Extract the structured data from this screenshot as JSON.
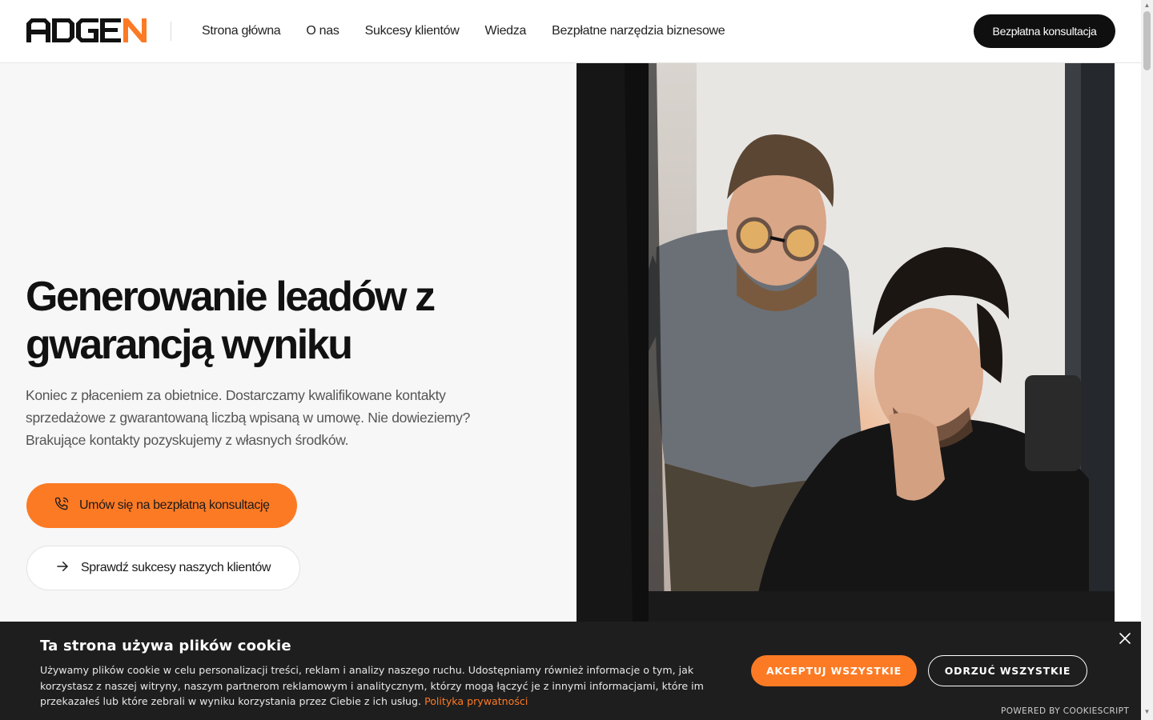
{
  "header": {
    "logo_text": "ADGEN",
    "nav": [
      {
        "label": "Strona główna"
      },
      {
        "label": "O nas"
      },
      {
        "label": "Sukcesy klientów"
      },
      {
        "label": "Wiedza"
      },
      {
        "label": "Bezpłatne narzędzia biznesowe"
      }
    ],
    "cta_label": "Bezpłatna konsultacja"
  },
  "hero": {
    "title_line1": "Generowanie leadów z",
    "title_line2": "gwarancją wyniku",
    "subtitle": "Koniec z płaceniem za obietnice. Dostarczamy kwalifikowane kontakty sprzedażowe z gwarantowaną liczbą wpisaną w umowę. Nie dowieziemy? Brakujące kontakty pozyskujemy z własnych środków.",
    "primary_button": "Umów się na bezpłatną konsultację",
    "primary_icon": "phone-icon",
    "secondary_button": "Sprawdź sukcesy naszych klientów",
    "secondary_icon": "arrow-right-icon"
  },
  "cookie": {
    "title": "Ta strona używa plików cookie",
    "text": "Używamy plików cookie w celu personalizacji treści, reklam i analizy naszego ruchu. Udostępniamy również informacje o tym, jak korzystasz z naszej witryny, naszym partnerom reklamowym i analitycznym, którzy mogą łączyć je z innymi informacjami, które im przekazałeś lub które zebrali w wyniku korzystania przez Ciebie z ich usług.",
    "privacy_link": "Polityka prywatności",
    "accept_label": "AKCEPTUJ WSZYSTKIE",
    "reject_label": "ODRZUĆ WSZYSTKIE",
    "close_icon": "close-icon",
    "powered_by": "POWERED BY COOKIESCRIPT"
  },
  "colors": {
    "accent": "#fd7a24",
    "dark": "#0f0f0f",
    "hero_bg": "#f7f7f7",
    "cookie_bg": "#1e1e1e"
  }
}
